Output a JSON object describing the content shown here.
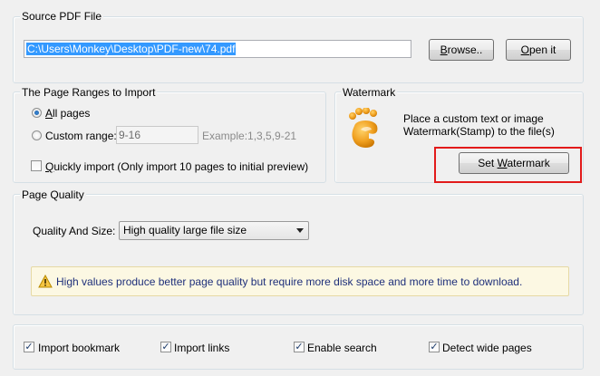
{
  "source": {
    "legend": "Source PDF File",
    "path_value": "C:\\Users\\Monkey\\Desktop\\PDF-new\\74.pdf",
    "browse_label": "Browse..",
    "open_label": "Open it"
  },
  "ranges": {
    "legend": "The Page Ranges to Import",
    "all_pages_label": "All pages",
    "custom_range_label": "Custom range:",
    "custom_range_value": "9-16",
    "example_text": "Example:1,3,5,9-21",
    "quick_import_label": "Quickly import (Only import 10 pages to  initial  preview)",
    "selected": "all_pages",
    "quick_import_checked": false
  },
  "watermark": {
    "legend": "Watermark",
    "description_line1": "Place a custom text or image",
    "description_line2": "Watermark(Stamp) to the file(s)",
    "set_label": "Set Watermark",
    "icon": "footprint-icon",
    "highlight_color": "#e21b1b"
  },
  "quality": {
    "legend": "Page Quality",
    "size_label": "Quality And Size:",
    "selected_option": "High quality large file size",
    "info_text": "High values produce better page quality but require more disk space and more time to download.",
    "info_icon": "warning-icon"
  },
  "options": {
    "import_bookmark": "Import bookmark",
    "import_links": "Import links",
    "enable_search": "Enable search",
    "detect_wide_pages": "Detect wide pages",
    "import_bookmark_checked": true,
    "import_links_checked": true,
    "enable_search_checked": true,
    "detect_wide_pages_checked": true
  }
}
